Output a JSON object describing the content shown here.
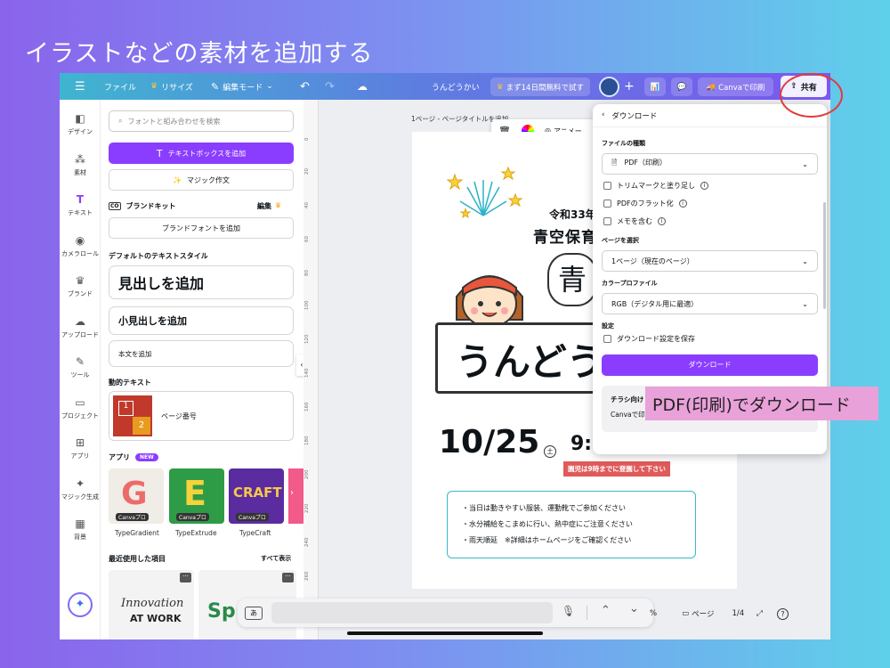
{
  "headline": "イラストなどの素材を追加する",
  "topbar": {
    "menu_icon": "hamburger-icon",
    "file": "ファイル",
    "resize": "リサイズ",
    "edit_mode": "編集モード",
    "title": "うんどうかい",
    "trial": "まず14日間無料で試す",
    "print": "Canvaで印刷",
    "share": "共有"
  },
  "rail": [
    {
      "label": "デザイン",
      "icon": "design-icon"
    },
    {
      "label": "素材",
      "icon": "elements-icon"
    },
    {
      "label": "テキスト",
      "icon": "text-icon"
    },
    {
      "label": "カメラロール",
      "icon": "camera-icon"
    },
    {
      "label": "ブランド",
      "icon": "brand-icon"
    },
    {
      "label": "アップロード",
      "icon": "upload-icon"
    },
    {
      "label": "ツール",
      "icon": "tools-icon"
    },
    {
      "label": "プロジェクト",
      "icon": "folder-icon"
    },
    {
      "label": "アプリ",
      "icon": "apps-icon"
    },
    {
      "label": "マジック生成",
      "icon": "magic-media-icon"
    },
    {
      "label": "背景",
      "icon": "background-icon"
    }
  ],
  "panel": {
    "search_placeholder": "フォントと組み合わせを検索",
    "add_textbox": "テキストボックスを追加",
    "magic_write": "マジック作文",
    "brand_kit": "ブランドキット",
    "brand_edit": "編集",
    "add_brand_font": "ブランドフォントを追加",
    "default_styles": "デフォルトのテキストスタイル",
    "heading": "見出しを追加",
    "subheading": "小見出しを追加",
    "body": "本文を追加",
    "dynamic_text": "動的テキスト",
    "page_number": "ページ番号",
    "page_thumb_1": "1",
    "page_thumb_2": "2",
    "apps": "アプリ",
    "new_badge": "NEW",
    "app_items": [
      {
        "name": "TypeGradient",
        "tag": "Canvaプロ",
        "glyph": "G"
      },
      {
        "name": "TypeExtrude",
        "tag": "Canvaプロ",
        "glyph": "E"
      },
      {
        "name": "TypeCraft",
        "tag": "Canvaプロ",
        "glyph": "CRAFT"
      }
    ],
    "recent": "最近使用した項目",
    "show_all": "すべて表示",
    "recent_1_a": "Innovation",
    "recent_1_b": "AT WORK",
    "recent_2": "Sp"
  },
  "canvas": {
    "page_title": "1ページ - ページタイトルを追加",
    "ruler": [
      "0",
      "20",
      "40",
      "60",
      "80",
      "100",
      "120",
      "140",
      "160",
      "180",
      "200",
      "220",
      "240",
      "260",
      "280"
    ],
    "animate": "アニメー"
  },
  "poster": {
    "year": "令和33年",
    "school": "青空保育",
    "kanji": "青",
    "title": "うんどう",
    "date": "10/25",
    "weekday": "土",
    "time": "9:",
    "notice": "園児は9時までに登園して下さい",
    "bullets": [
      "・当日は動きやすい服装、運動靴でご参加ください",
      "・水分補給をこまめに行い、熱中症にご注意ください",
      "・雨天順延　※詳細はホームページをご確認ください"
    ]
  },
  "download": {
    "back": "ダウンロード",
    "file_type_label": "ファイルの種類",
    "file_type": "PDF（印刷）",
    "trim": "トリムマークと塗り足し",
    "flatten": "PDFのフラット化",
    "notes": "メモを含む",
    "select_pages_label": "ページを選択",
    "pages": "1ページ（現在のページ）",
    "color_profile_label": "カラープロファイル",
    "color_profile": "RGB（デジタル用に最適）",
    "settings_label": "設定",
    "save_settings": "ダウンロード設定を保存",
    "button": "ダウンロード",
    "promo_title": "チラシ向け",
    "promo_text": "Canvaで印"
  },
  "callout": "PDF(印刷)でダウンロード",
  "bottom": {
    "kana_key": "あ",
    "zoom": "%",
    "pages_label": "ページ",
    "page_count": "1/4"
  }
}
